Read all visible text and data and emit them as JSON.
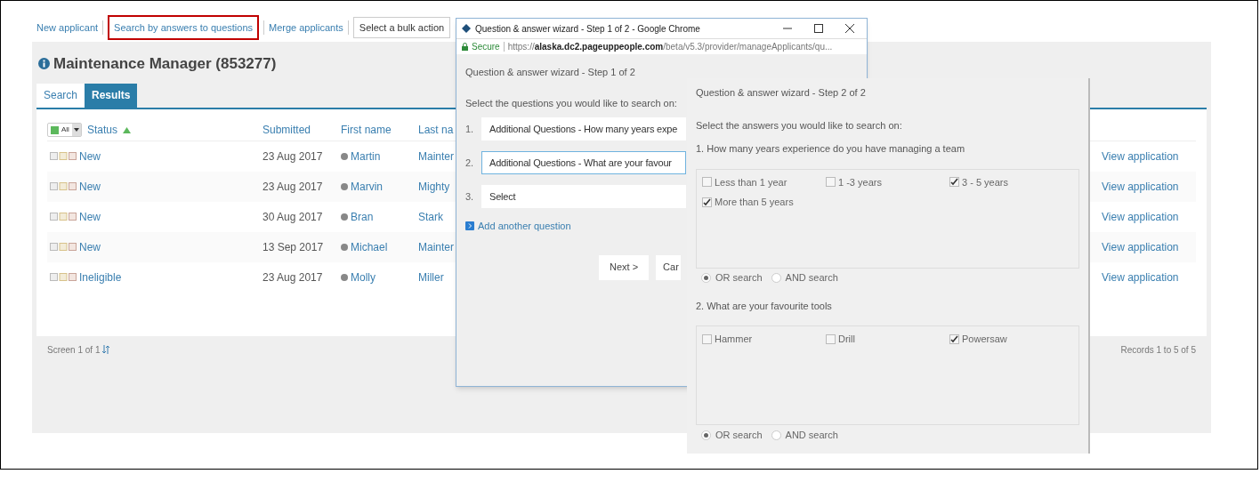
{
  "toolbar": {
    "links": [
      {
        "label": "New applicant",
        "highlighted": false
      },
      {
        "label": "Search by answers to questions",
        "highlighted": true
      },
      {
        "label": "Merge applicants",
        "highlighted": false
      }
    ],
    "bulk_action": "Select a bulk action"
  },
  "page": {
    "title": "Maintenance Manager (853277)",
    "tabs": [
      {
        "label": "Search",
        "selected": false
      },
      {
        "label": "Results",
        "selected": true
      }
    ]
  },
  "table": {
    "select_all": "All",
    "columns": [
      "Status",
      "Submitted",
      "First name",
      "Last na"
    ],
    "rows": [
      {
        "status": "New",
        "submitted": "23 Aug 2017",
        "first_name": "Martin",
        "last_name": "Mainter",
        "action": "View application"
      },
      {
        "status": "New",
        "submitted": "23 Aug 2017",
        "first_name": "Marvin",
        "last_name": "Mighty",
        "action": "View application"
      },
      {
        "status": "New",
        "submitted": "30 Aug 2017",
        "first_name": "Bran",
        "last_name": "Stark",
        "action": "View application"
      },
      {
        "status": "New",
        "submitted": "13 Sep 2017",
        "first_name": "Michael",
        "last_name": "Mainter",
        "action": "View application"
      },
      {
        "status": "Ineligible",
        "submitted": "23 Aug 2017",
        "first_name": "Molly",
        "last_name": "Miller",
        "action": "View application"
      }
    ],
    "pager": "Screen 1 of 1",
    "records": "Records 1 to 5 of 5"
  },
  "popup": {
    "window_title": "Question & answer wizard - Step 1 of 2 - Google Chrome",
    "secure": "Secure",
    "url": "https://**alaska.dc2.pageuppeople.com**/beta/v5.3/provider/manageApplicants/qu...",
    "heading": "Question & answer wizard - Step 1 of 2",
    "prompt": "Select the questions you would like to search on:",
    "questions": [
      {
        "number": "1.",
        "value": "Additional Questions - How many years expe",
        "focused": false
      },
      {
        "number": "2.",
        "value": "Additional Questions - What are your favour",
        "focused": true
      },
      {
        "number": "3.",
        "value": "Select",
        "focused": false
      }
    ],
    "add_link": "Add another question",
    "buttons": [
      "Next >",
      "Car"
    ]
  },
  "step2": {
    "heading": "Question & answer wizard - Step 2 of 2",
    "prompt": "Select the answers you would like to search on:",
    "groups": [
      {
        "question": "1. How many years experience do you have managing a team",
        "options": [
          {
            "label": "Less than 1 year",
            "checked": false
          },
          {
            "label": "1 -3 years",
            "checked": false
          },
          {
            "label": "3 - 5 years",
            "checked": true
          },
          {
            "label": "More than 5 years",
            "checked": true
          }
        ],
        "modes": [
          {
            "label": "OR search",
            "selected": true
          },
          {
            "label": "AND search",
            "selected": false
          }
        ]
      },
      {
        "question": "2. What are your favourite tools",
        "options": [
          {
            "label": "Hammer",
            "checked": false
          },
          {
            "label": "Drill",
            "checked": false
          },
          {
            "label": "Powersaw",
            "checked": true
          }
        ],
        "modes": [
          {
            "label": "OR search",
            "selected": true
          },
          {
            "label": "AND search",
            "selected": false
          }
        ]
      }
    ]
  }
}
